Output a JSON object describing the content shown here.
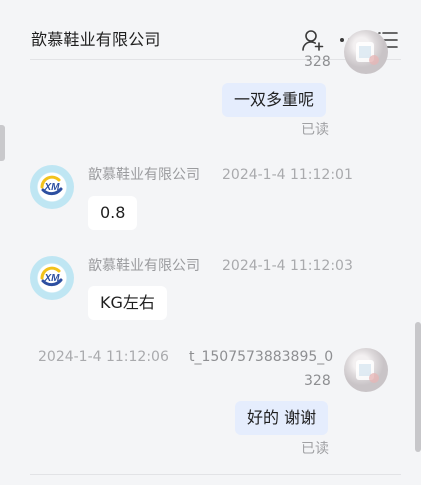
{
  "header": {
    "title": "歆慕鞋业有限公司",
    "icons": [
      "add-user-icon",
      "more-icon",
      "menu-icon"
    ]
  },
  "messages": {
    "m0": {
      "id_tail": "328",
      "avatar": "user-avatar"
    },
    "m1": {
      "text": "一双多重呢",
      "status": "已读"
    },
    "m2": {
      "sender": "歆慕鞋业有限公司",
      "time": "2024-1-4 11:12:01",
      "text": "0.8"
    },
    "m3": {
      "sender": "歆慕鞋业有限公司",
      "time": "2024-1-4 11:12:03",
      "text": "KG左右"
    },
    "m4": {
      "time": "2024-1-4 11:12:06",
      "sender_line1": "t_1507573883895_0",
      "sender_line2": "328",
      "text": "好的 谢谢",
      "status": "已读"
    }
  },
  "colors": {
    "background": "#f4f5f7",
    "outgoing_bubble": "#e5edfd",
    "incoming_bubble": "#ffffff",
    "muted_text": "#9a9b9e"
  }
}
